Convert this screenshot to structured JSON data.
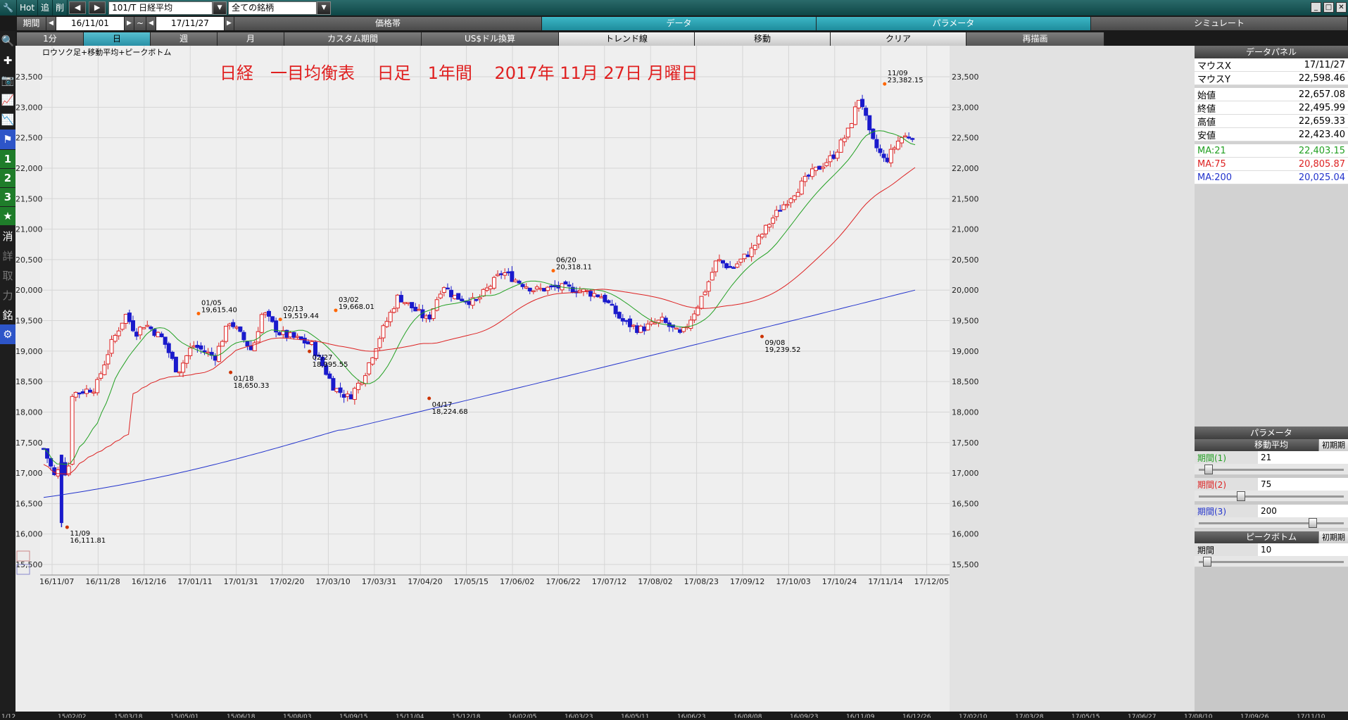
{
  "topbar": {
    "hot": "Hot",
    "tsui": "追",
    "sakujo": "削",
    "symbol": "101/T 日経平均",
    "market": "全ての銘柄",
    "period_label": "期間",
    "date_from": "16/11/01",
    "tilde": "~",
    "date_to": "17/11/27"
  },
  "row2": {
    "kakakutai": "価格帯",
    "data": "データ",
    "parameter": "パラメータ",
    "simulate": "シミュレート"
  },
  "row3": [
    {
      "label": "1分"
    },
    {
      "label": "日"
    },
    {
      "label": "週"
    },
    {
      "label": "月"
    },
    {
      "label": "カスタム期間"
    },
    {
      "label": "US$ドル換算"
    },
    {
      "label": "トレンド線"
    },
    {
      "label": "移動"
    },
    {
      "label": "クリア"
    },
    {
      "label": "再描画"
    }
  ],
  "chart": {
    "indicator_label": "ロウソク足+移動平均+ピークボトム",
    "title": "日経　一目均衡表　 日足　1年間　 2017年 11月 27日 月曜日",
    "y_ticks": [
      "15,500",
      "16,000",
      "16,500",
      "17,000",
      "17,500",
      "18,000",
      "18,500",
      "19,000",
      "19,500",
      "20,000",
      "20,500",
      "21,000",
      "21,500",
      "22,000",
      "22,500",
      "23,000",
      "23,500"
    ],
    "x_ticks": [
      "16/11/07",
      "16/11/28",
      "16/12/16",
      "17/01/11",
      "17/01/31",
      "17/02/20",
      "17/03/10",
      "17/03/31",
      "17/04/20",
      "17/05/15",
      "17/06/02",
      "17/06/22",
      "17/07/12",
      "17/08/02",
      "17/08/23",
      "17/09/12",
      "17/10/03",
      "17/10/24",
      "17/11/14",
      "17/12/05"
    ],
    "bottom_ticks": [
      "1/12",
      "15/02/02",
      "15/03/18",
      "15/05/01",
      "15/06/18",
      "15/08/03",
      "15/09/15",
      "15/11/04",
      "15/12/18",
      "16/02/05",
      "16/03/23",
      "16/05/11",
      "16/06/23",
      "16/08/08",
      "16/09/23",
      "16/11/09",
      "16/12/26",
      "17/02/10",
      "17/03/28",
      "17/05/15",
      "17/06/27",
      "17/08/10",
      "17/09/26",
      "17/11/10"
    ],
    "peaks": [
      {
        "date": "11/09",
        "value": "16,111.81",
        "kind": "bottom"
      },
      {
        "date": "01/05",
        "value": "19,615.40",
        "kind": "peak"
      },
      {
        "date": "01/18",
        "value": "18,650.33",
        "kind": "bottom"
      },
      {
        "date": "02/13",
        "value": "19,519.44",
        "kind": "peak"
      },
      {
        "date": "02/27",
        "value": "18,995.55",
        "kind": "bottom"
      },
      {
        "date": "03/02",
        "value": "19,668.01",
        "kind": "peak"
      },
      {
        "date": "04/17",
        "value": "18,224.68",
        "kind": "bottom"
      },
      {
        "date": "06/20",
        "value": "20,318.11",
        "kind": "peak"
      },
      {
        "date": "09/08",
        "value": "19,239.52",
        "kind": "bottom"
      },
      {
        "date": "11/09",
        "value": "23,382.15",
        "kind": "peak"
      }
    ]
  },
  "chart_data": {
    "type": "candlestick",
    "ylim": [
      15500,
      23700
    ],
    "series": [
      {
        "name": "MA:21"
      },
      {
        "name": "MA:75"
      },
      {
        "name": "MA:200"
      }
    ],
    "ma_colors": {
      "MA:21": "#22a022",
      "MA:75": "#dd2222",
      "MA:200": "#2233cc"
    },
    "up_color": "#dd2222",
    "down_color": "#1a1acc"
  },
  "data_panel": {
    "title": "データパネル",
    "rows": [
      {
        "k": "マウスX",
        "v": "17/11/27"
      },
      {
        "k": "マウスY",
        "v": "22,598.46"
      },
      {
        "k": "始値",
        "v": "22,657.08"
      },
      {
        "k": "終値",
        "v": "22,495.99"
      },
      {
        "k": "高値",
        "v": "22,659.33"
      },
      {
        "k": "安値",
        "v": "22,423.40"
      },
      {
        "k": "MA:21",
        "v": "22,403.15"
      },
      {
        "k": "MA:75",
        "v": "20,805.87"
      },
      {
        "k": "MA:200",
        "v": "20,025.04"
      }
    ]
  },
  "param_panel": {
    "title": "パラメータ",
    "ma_title": "移動平均",
    "init": "初期期",
    "periods": [
      {
        "label": "期間(1)",
        "value": "21"
      },
      {
        "label": "期間(2)",
        "value": "75"
      },
      {
        "label": "期間(3)",
        "value": "200"
      }
    ],
    "pb_title": "ピークボトム",
    "pb_label": "期間",
    "pb_value": "10"
  }
}
